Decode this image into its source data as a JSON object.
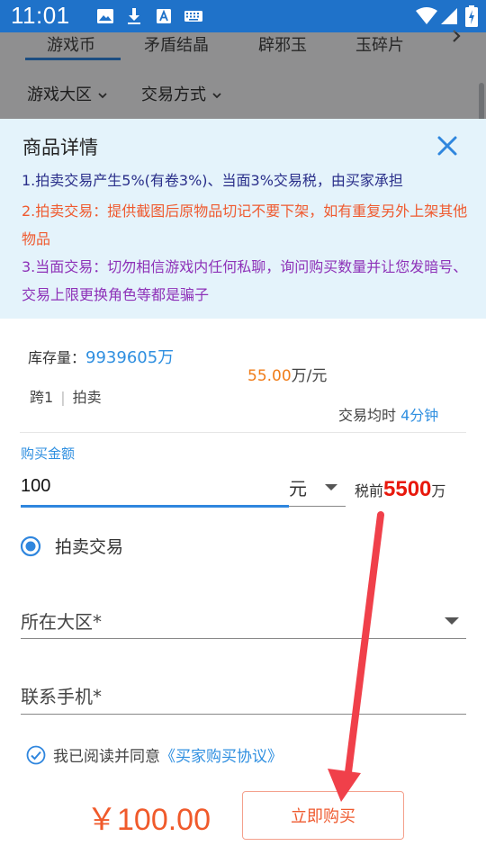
{
  "status_bar": {
    "time": "11:01"
  },
  "background_page": {
    "tabs": [
      "游戏币",
      "矛盾结晶",
      "辟邪玉",
      "玉碎片"
    ],
    "filters": [
      "游戏大区",
      "交易方式"
    ]
  },
  "dialog": {
    "title": "商品详情",
    "notice_1": "1.拍卖交易产生5%(有卷3%)、当面3%交易税，由买家承担",
    "notice_2": "2.拍卖交易：提供截图后原物品切记不要下架，如有重复另外上架其他物品",
    "notice_3": "3.当面交易：切勿相信游戏内任何私聊，询问购买数量并让您发暗号、交易上限更换角色等都是骗子"
  },
  "item": {
    "stock_label": "库存量：",
    "stock_value": "9939605万",
    "price_value": "55.00",
    "price_unit": "万/元",
    "server": "跨1",
    "trade_type": "拍卖",
    "avg_time_label": "交易均时",
    "avg_time_value": "4分钟"
  },
  "purchase": {
    "amount_label": "购买金额",
    "amount_value": "100",
    "unit": "元",
    "pretax_label": "税前",
    "pretax_value": "5500",
    "pretax_unit": "万",
    "radio_label": "拍卖交易",
    "region_placeholder": "所在大区*",
    "phone_placeholder": "联系手机*",
    "agree_text": "我已阅读并同意",
    "agree_link": "《买家购买协议》",
    "total": "￥100.00",
    "buy_label": "立即购买"
  },
  "colors": {
    "status_bar": "#1f72c9",
    "accent_blue": "#2f86de",
    "price_orange": "#f07d1a",
    "total_red": "#f05a2b",
    "annotation_red": "#f0404a"
  },
  "icons": [
    "image-icon",
    "download-icon",
    "text-icon",
    "keyboard-icon",
    "wifi-icon",
    "signal-icon",
    "battery-icon",
    "chevron-right-icon",
    "chevron-down-icon",
    "close-icon",
    "dropdown-arrow-icon",
    "radio-checked-icon",
    "check-circle-icon",
    "annotation-arrow"
  ]
}
